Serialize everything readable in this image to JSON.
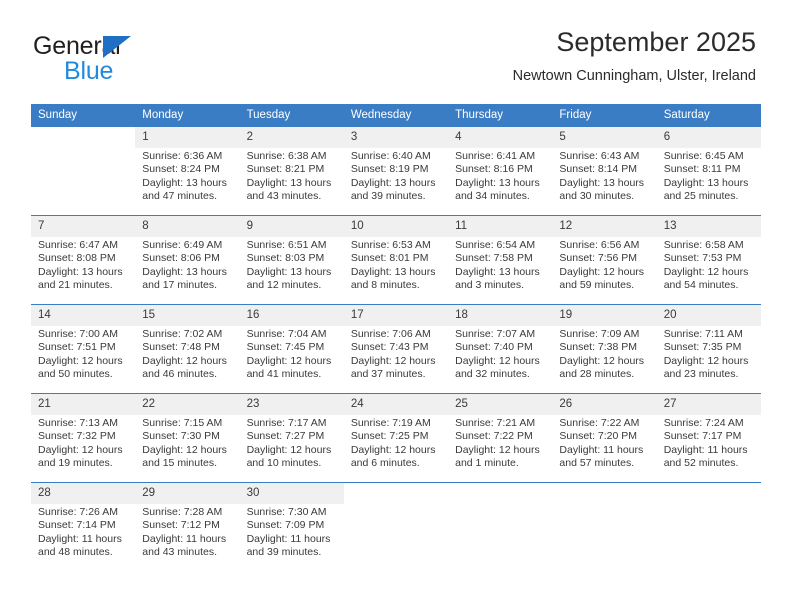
{
  "logo": {
    "word_top": "General",
    "word_bottom": "Blue",
    "triangle_icon": "triangle-icon",
    "color_dark": "#231f20",
    "color_blue": "#1f8ae0",
    "color_triangle": "#1f6fc4"
  },
  "header": {
    "title": "September 2025",
    "subtitle": "Newtown Cunningham, Ulster, Ireland"
  },
  "colors": {
    "header_blue": "#3b7dc4",
    "daynum_band": "#f0f0f0",
    "text": "#3a3a3a"
  },
  "calendar": {
    "weekday_headers": [
      "Sunday",
      "Monday",
      "Tuesday",
      "Wednesday",
      "Thursday",
      "Friday",
      "Saturday"
    ],
    "weeks": [
      [
        {
          "day": "",
          "sunrise": "",
          "sunset": "",
          "daylight": ""
        },
        {
          "day": "1",
          "sunrise": "Sunrise: 6:36 AM",
          "sunset": "Sunset: 8:24 PM",
          "daylight": "Daylight: 13 hours and 47 minutes."
        },
        {
          "day": "2",
          "sunrise": "Sunrise: 6:38 AM",
          "sunset": "Sunset: 8:21 PM",
          "daylight": "Daylight: 13 hours and 43 minutes."
        },
        {
          "day": "3",
          "sunrise": "Sunrise: 6:40 AM",
          "sunset": "Sunset: 8:19 PM",
          "daylight": "Daylight: 13 hours and 39 minutes."
        },
        {
          "day": "4",
          "sunrise": "Sunrise: 6:41 AM",
          "sunset": "Sunset: 8:16 PM",
          "daylight": "Daylight: 13 hours and 34 minutes."
        },
        {
          "day": "5",
          "sunrise": "Sunrise: 6:43 AM",
          "sunset": "Sunset: 8:14 PM",
          "daylight": "Daylight: 13 hours and 30 minutes."
        },
        {
          "day": "6",
          "sunrise": "Sunrise: 6:45 AM",
          "sunset": "Sunset: 8:11 PM",
          "daylight": "Daylight: 13 hours and 25 minutes."
        }
      ],
      [
        {
          "day": "7",
          "sunrise": "Sunrise: 6:47 AM",
          "sunset": "Sunset: 8:08 PM",
          "daylight": "Daylight: 13 hours and 21 minutes."
        },
        {
          "day": "8",
          "sunrise": "Sunrise: 6:49 AM",
          "sunset": "Sunset: 8:06 PM",
          "daylight": "Daylight: 13 hours and 17 minutes."
        },
        {
          "day": "9",
          "sunrise": "Sunrise: 6:51 AM",
          "sunset": "Sunset: 8:03 PM",
          "daylight": "Daylight: 13 hours and 12 minutes."
        },
        {
          "day": "10",
          "sunrise": "Sunrise: 6:53 AM",
          "sunset": "Sunset: 8:01 PM",
          "daylight": "Daylight: 13 hours and 8 minutes."
        },
        {
          "day": "11",
          "sunrise": "Sunrise: 6:54 AM",
          "sunset": "Sunset: 7:58 PM",
          "daylight": "Daylight: 13 hours and 3 minutes."
        },
        {
          "day": "12",
          "sunrise": "Sunrise: 6:56 AM",
          "sunset": "Sunset: 7:56 PM",
          "daylight": "Daylight: 12 hours and 59 minutes."
        },
        {
          "day": "13",
          "sunrise": "Sunrise: 6:58 AM",
          "sunset": "Sunset: 7:53 PM",
          "daylight": "Daylight: 12 hours and 54 minutes."
        }
      ],
      [
        {
          "day": "14",
          "sunrise": "Sunrise: 7:00 AM",
          "sunset": "Sunset: 7:51 PM",
          "daylight": "Daylight: 12 hours and 50 minutes."
        },
        {
          "day": "15",
          "sunrise": "Sunrise: 7:02 AM",
          "sunset": "Sunset: 7:48 PM",
          "daylight": "Daylight: 12 hours and 46 minutes."
        },
        {
          "day": "16",
          "sunrise": "Sunrise: 7:04 AM",
          "sunset": "Sunset: 7:45 PM",
          "daylight": "Daylight: 12 hours and 41 minutes."
        },
        {
          "day": "17",
          "sunrise": "Sunrise: 7:06 AM",
          "sunset": "Sunset: 7:43 PM",
          "daylight": "Daylight: 12 hours and 37 minutes."
        },
        {
          "day": "18",
          "sunrise": "Sunrise: 7:07 AM",
          "sunset": "Sunset: 7:40 PM",
          "daylight": "Daylight: 12 hours and 32 minutes."
        },
        {
          "day": "19",
          "sunrise": "Sunrise: 7:09 AM",
          "sunset": "Sunset: 7:38 PM",
          "daylight": "Daylight: 12 hours and 28 minutes."
        },
        {
          "day": "20",
          "sunrise": "Sunrise: 7:11 AM",
          "sunset": "Sunset: 7:35 PM",
          "daylight": "Daylight: 12 hours and 23 minutes."
        }
      ],
      [
        {
          "day": "21",
          "sunrise": "Sunrise: 7:13 AM",
          "sunset": "Sunset: 7:32 PM",
          "daylight": "Daylight: 12 hours and 19 minutes."
        },
        {
          "day": "22",
          "sunrise": "Sunrise: 7:15 AM",
          "sunset": "Sunset: 7:30 PM",
          "daylight": "Daylight: 12 hours and 15 minutes."
        },
        {
          "day": "23",
          "sunrise": "Sunrise: 7:17 AM",
          "sunset": "Sunset: 7:27 PM",
          "daylight": "Daylight: 12 hours and 10 minutes."
        },
        {
          "day": "24",
          "sunrise": "Sunrise: 7:19 AM",
          "sunset": "Sunset: 7:25 PM",
          "daylight": "Daylight: 12 hours and 6 minutes."
        },
        {
          "day": "25",
          "sunrise": "Sunrise: 7:21 AM",
          "sunset": "Sunset: 7:22 PM",
          "daylight": "Daylight: 12 hours and 1 minute."
        },
        {
          "day": "26",
          "sunrise": "Sunrise: 7:22 AM",
          "sunset": "Sunset: 7:20 PM",
          "daylight": "Daylight: 11 hours and 57 minutes."
        },
        {
          "day": "27",
          "sunrise": "Sunrise: 7:24 AM",
          "sunset": "Sunset: 7:17 PM",
          "daylight": "Daylight: 11 hours and 52 minutes."
        }
      ],
      [
        {
          "day": "28",
          "sunrise": "Sunrise: 7:26 AM",
          "sunset": "Sunset: 7:14 PM",
          "daylight": "Daylight: 11 hours and 48 minutes."
        },
        {
          "day": "29",
          "sunrise": "Sunrise: 7:28 AM",
          "sunset": "Sunset: 7:12 PM",
          "daylight": "Daylight: 11 hours and 43 minutes."
        },
        {
          "day": "30",
          "sunrise": "Sunrise: 7:30 AM",
          "sunset": "Sunset: 7:09 PM",
          "daylight": "Daylight: 11 hours and 39 minutes."
        },
        {
          "day": "",
          "sunrise": "",
          "sunset": "",
          "daylight": ""
        },
        {
          "day": "",
          "sunrise": "",
          "sunset": "",
          "daylight": ""
        },
        {
          "day": "",
          "sunrise": "",
          "sunset": "",
          "daylight": ""
        },
        {
          "day": "",
          "sunrise": "",
          "sunset": "",
          "daylight": ""
        }
      ]
    ]
  }
}
